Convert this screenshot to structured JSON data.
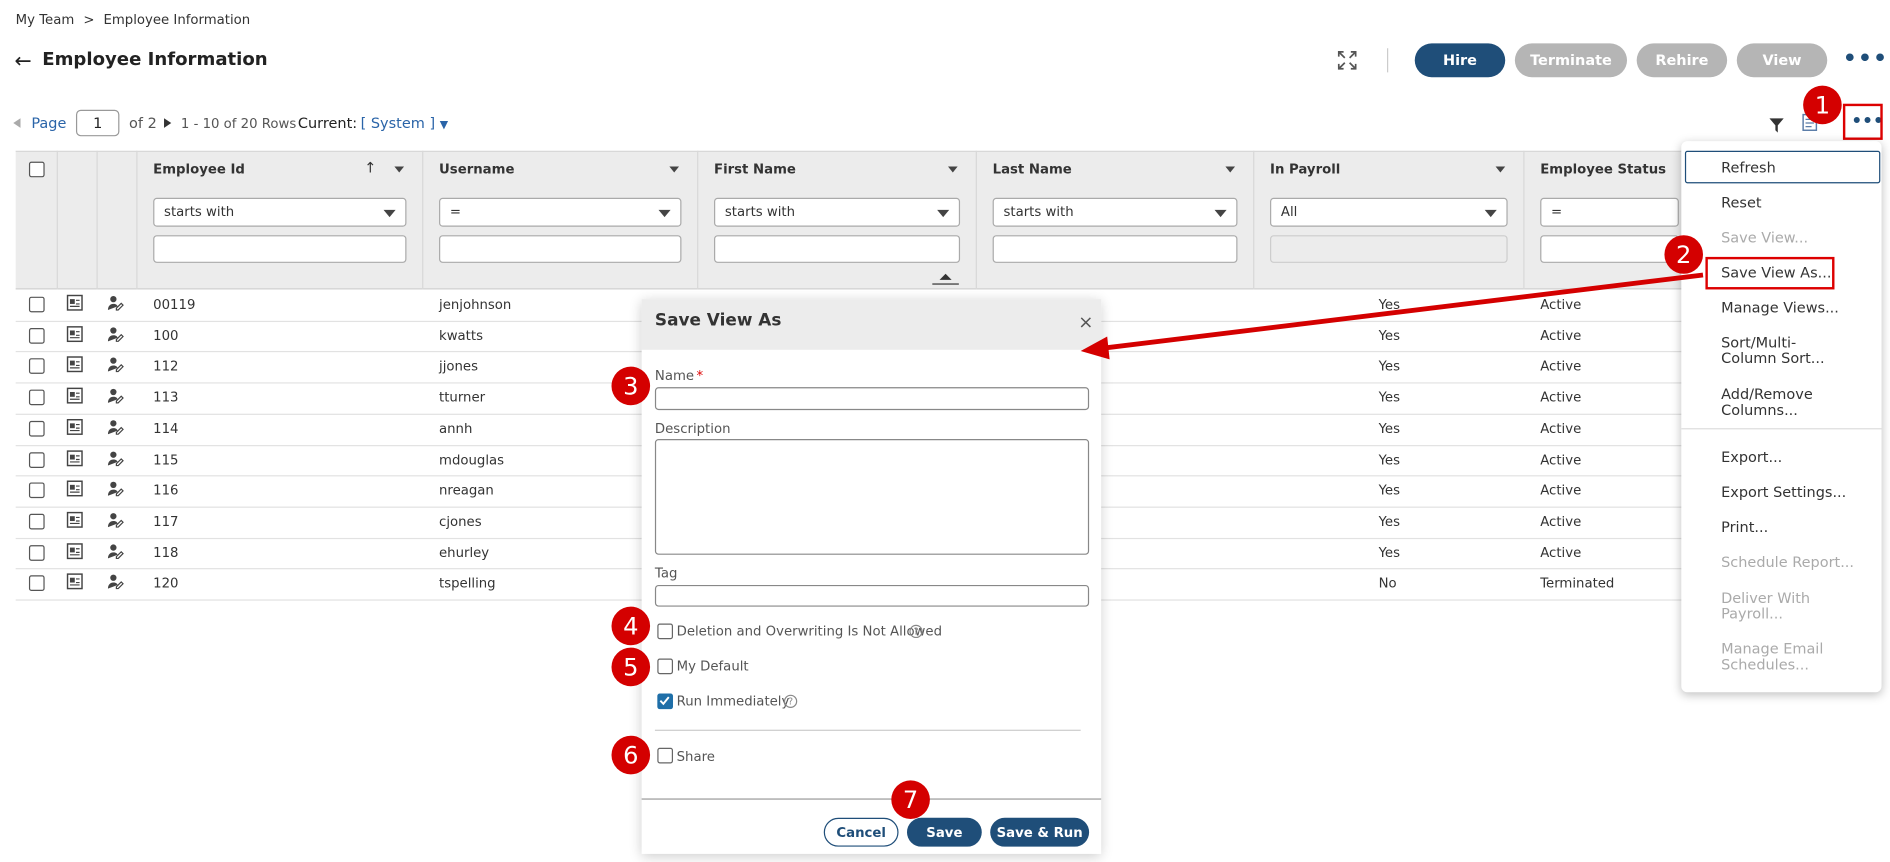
{
  "breadcrumb": {
    "parent": "My Team",
    "separator": ">",
    "current": "Employee Information"
  },
  "page_title": "Employee Information",
  "header_buttons": {
    "hire": "Hire",
    "terminate": "Terminate",
    "rehire": "Rehire",
    "view": "View",
    "more": "•••"
  },
  "pager": {
    "page_label": "Page",
    "page_value": "1",
    "of_text": "of 2",
    "rows_text": "1 - 10 of 20 Rows",
    "current_label": "Current:",
    "current_view": "[ System ]"
  },
  "toolbar": {
    "more": "•••"
  },
  "columns": {
    "employee_id": "Employee Id",
    "username": "Username",
    "first_name": "First Name",
    "last_name": "Last Name",
    "in_payroll": "In Payroll",
    "employee_status": "Employee Status"
  },
  "filters": {
    "starts_with": "starts with",
    "equals": "=",
    "all": "All"
  },
  "rows": [
    {
      "id": "00119",
      "username": "jenjohnson",
      "payroll": "Yes",
      "status": "Active"
    },
    {
      "id": "100",
      "username": "kwatts",
      "payroll": "Yes",
      "status": "Active"
    },
    {
      "id": "112",
      "username": "jjones",
      "payroll": "Yes",
      "status": "Active"
    },
    {
      "id": "113",
      "username": "tturner",
      "payroll": "Yes",
      "status": "Active"
    },
    {
      "id": "114",
      "username": "annh",
      "payroll": "Yes",
      "status": "Active"
    },
    {
      "id": "115",
      "username": "mdouglas",
      "payroll": "Yes",
      "status": "Active"
    },
    {
      "id": "116",
      "username": "nreagan",
      "payroll": "Yes",
      "status": "Active"
    },
    {
      "id": "117",
      "username": "cjones",
      "payroll": "Yes",
      "status": "Active"
    },
    {
      "id": "118",
      "username": "ehurley",
      "payroll": "Yes",
      "status": "Active"
    },
    {
      "id": "120",
      "username": "tspelling",
      "payroll": "No",
      "status": "Terminated"
    }
  ],
  "menu": {
    "refresh": "Refresh",
    "reset": "Reset",
    "save_view": "Save View...",
    "save_view_as": "Save View As...",
    "manage_views": "Manage Views...",
    "sort": "Sort/Multi-\nColumn Sort...",
    "add_remove": "Add/Remove\nColumns...",
    "export": "Export...",
    "export_settings": "Export Settings...",
    "print": "Print...",
    "schedule_report": "Schedule Report...",
    "deliver_payroll": "Deliver With\nPayroll...",
    "manage_email": "Manage Email\nSchedules..."
  },
  "dialog": {
    "title": "Save View As",
    "close": "×",
    "name_label": "Name",
    "required_mark": "*",
    "description_label": "Description",
    "tag_label": "Tag",
    "deletion_label": "Deletion and Overwriting Is Not Allowed",
    "my_default_label": "My Default",
    "run_immediately_label": "Run Immediately",
    "share_label": "Share",
    "help_glyph": "?",
    "cancel": "Cancel",
    "save": "Save",
    "save_run": "Save & Run"
  },
  "steps": [
    "1",
    "2",
    "3",
    "4",
    "5",
    "6",
    "7"
  ],
  "colors": {
    "accent": "#1f4e79",
    "disabled_pill": "#b5b5b5",
    "annotation": "#d40000",
    "link": "#2a64a8"
  }
}
